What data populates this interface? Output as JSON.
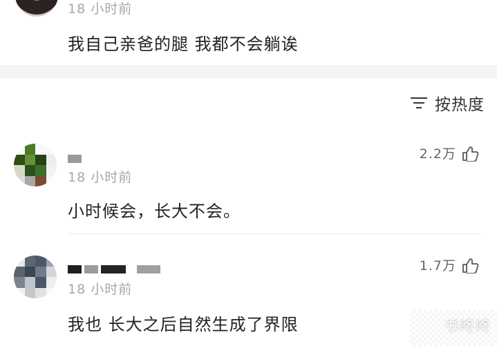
{
  "top_comment": {
    "time": "18 小时前",
    "text": "我自己亲爸的腿 我都不会躺诶"
  },
  "sort": {
    "label": "按热度",
    "icon": "sort-lines-icon"
  },
  "comments": [
    {
      "time": "18 小时前",
      "likes": "2.2万",
      "text": "小时候会，长大不会。"
    },
    {
      "time": "18 小时前",
      "likes": "1.7万",
      "text": "我也  长大之后自然生成了界限"
    }
  ],
  "watermark": "书咚咚",
  "colors": {
    "time_gray": "#a7a7a7",
    "section_bg": "#f4f4f4",
    "text_dark": "#222222"
  }
}
